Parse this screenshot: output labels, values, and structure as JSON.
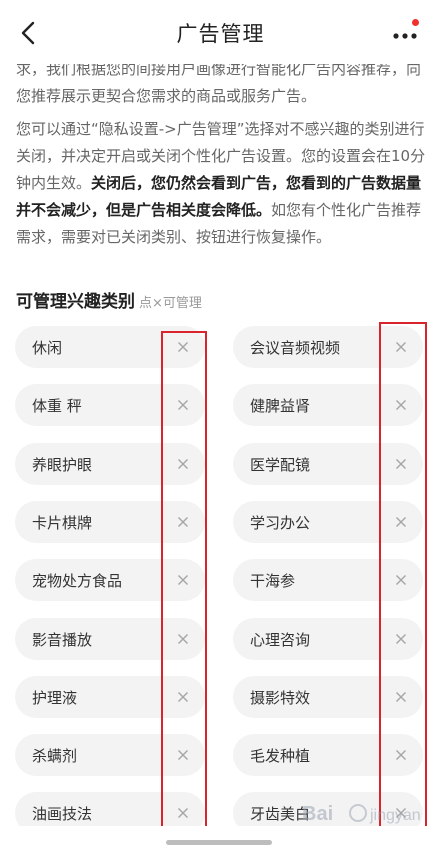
{
  "header": {
    "title": "广告管理",
    "back_icon": "chevron-left-icon",
    "more_icon": "more-dots-icon",
    "notify_color": "#f0302c"
  },
  "description": {
    "partial_top": "求，我们根据您的间接用户画像进行智能化广告内容推荐，向您推荐展示更契合您需求的商品或服务广告。",
    "p2_a": "您可以通过“隐私设置->广告管理”选择对不感兴趣的类别进行关闭，并决定开启或关闭个性化广告设置。您的设置会在10分钟内生效。",
    "p2_bold": "关闭后，您仍然会看到广告，您看到的广告数据量并不会减少，但是广告相关度会降低。",
    "p2_c": "如您有个性化广告推荐需求，需要对已关闭类别、按钮进行恢复操作。"
  },
  "section": {
    "title": "可管理兴趣类别",
    "hint": "点×可管理"
  },
  "categories_left": [
    "休闲",
    "体重 秤",
    "养眼护眼",
    "卡片棋牌",
    "宠物处方食品",
    "影音播放",
    "护理液",
    "杀螨剂",
    "油画技法"
  ],
  "categories_right": [
    "会议音频视频",
    "健脾益肾",
    "医学配镜",
    "学习办公",
    "干海参",
    "心理咨询",
    "摄影特效",
    "毛发种植",
    "牙齿美白"
  ],
  "colors": {
    "pill_bg": "#f3f3f3",
    "highlight": "#d9232d"
  }
}
